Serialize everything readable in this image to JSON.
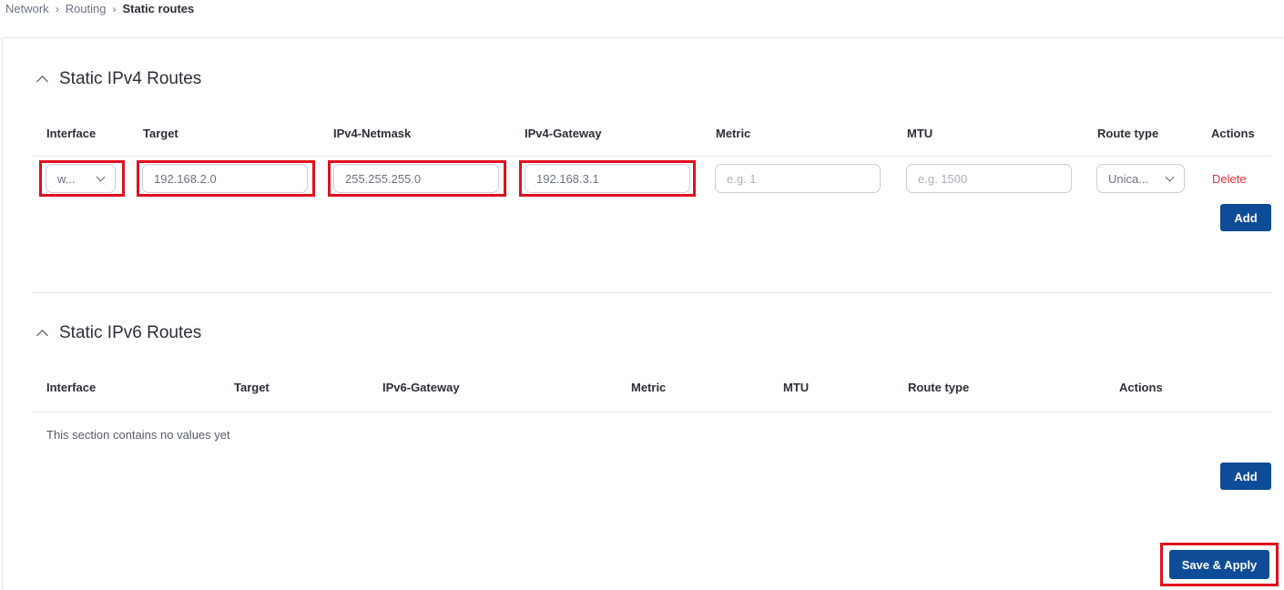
{
  "breadcrumb": {
    "items": [
      "Network",
      "Routing"
    ],
    "current": "Static routes"
  },
  "ipv4": {
    "title": "Static IPv4 Routes",
    "columns": [
      "Interface",
      "Target",
      "IPv4-Netmask",
      "IPv4-Gateway",
      "Metric",
      "MTU",
      "Route type",
      "Actions"
    ],
    "row": {
      "interface": "w...",
      "target": "192.168.2.0",
      "netmask": "255.255.255.0",
      "gateway": "192.168.3.1",
      "metric_placeholder": "e.g. 1",
      "mtu_placeholder": "e.g. 1500",
      "route_type": "Unica...",
      "delete_label": "Delete"
    },
    "add_label": "Add"
  },
  "ipv6": {
    "title": "Static IPv6 Routes",
    "columns": [
      "Interface",
      "Target",
      "IPv6-Gateway",
      "Metric",
      "MTU",
      "Route type",
      "Actions"
    ],
    "empty_text": "This section contains no values yet",
    "add_label": "Add"
  },
  "save_apply_label": "Save & Apply",
  "colors": {
    "primary": "#0f4c97",
    "danger": "#e0303a",
    "highlight": "#e0101e"
  }
}
